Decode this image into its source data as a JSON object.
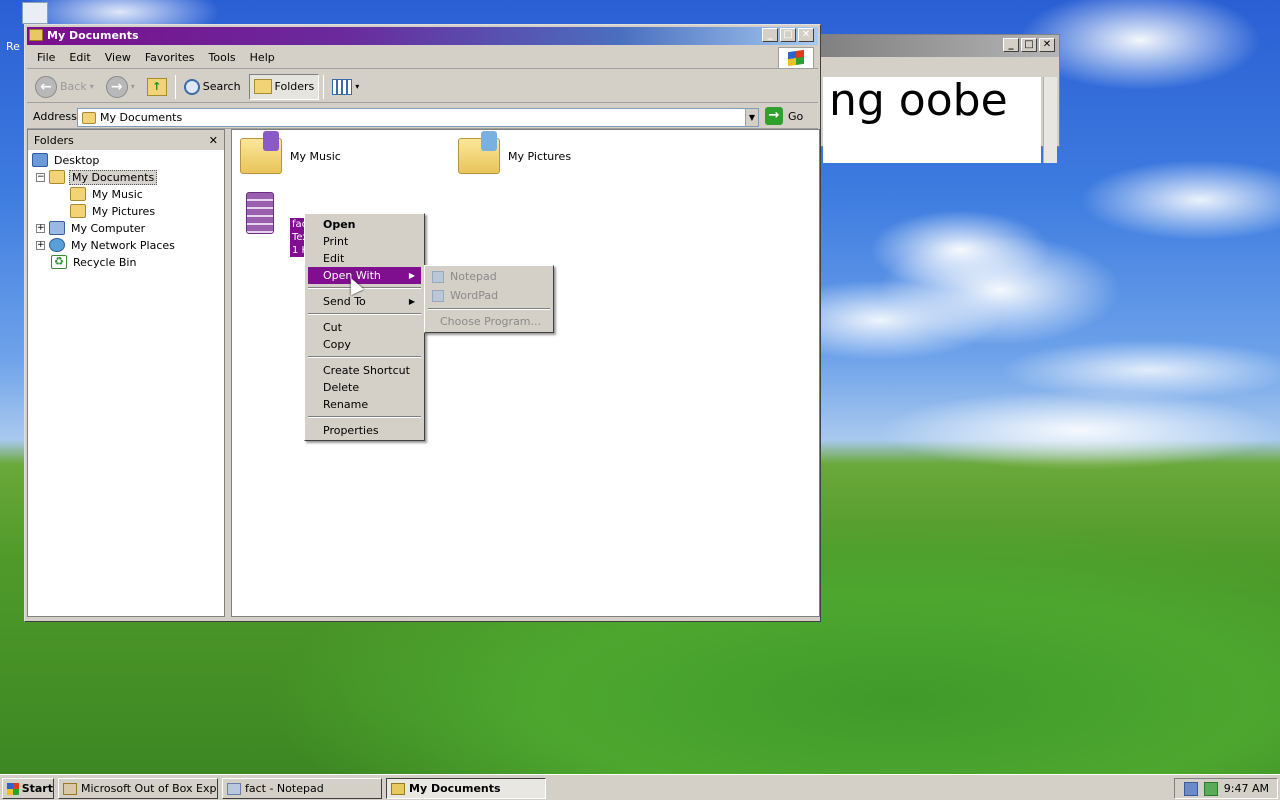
{
  "desktop": {
    "recycle_partial_label": "Re"
  },
  "background_window": {
    "content_text": "ng oobe"
  },
  "window": {
    "title": "My Documents",
    "controls": {
      "minimize": "_",
      "maximize": "□",
      "close": "✕"
    },
    "menu": [
      "File",
      "Edit",
      "View",
      "Favorites",
      "Tools",
      "Help"
    ],
    "toolbar": {
      "back": "Back",
      "search": "Search",
      "folders": "Folders"
    },
    "address": {
      "label": "Address",
      "value": "My Documents",
      "go": "Go"
    }
  },
  "folders_pane": {
    "title": "Folders",
    "close": "✕",
    "tree": [
      {
        "label": "Desktop"
      },
      {
        "label": "My Documents",
        "selected": true
      },
      {
        "label": "My Music"
      },
      {
        "label": "My Pictures"
      },
      {
        "label": "My Computer"
      },
      {
        "label": "My Network Places"
      },
      {
        "label": "Recycle Bin"
      }
    ]
  },
  "content": {
    "items": [
      {
        "label": "My Music"
      },
      {
        "label": "My Pictures"
      }
    ],
    "file": {
      "line1": "fact",
      "line2": "Text Document",
      "line3": "1 KB"
    }
  },
  "context_menu": {
    "items": [
      "Open",
      "Print",
      "Edit",
      "Open With",
      "Send To",
      "Cut",
      "Copy",
      "Create Shortcut",
      "Delete",
      "Rename",
      "Properties"
    ]
  },
  "open_with_menu": {
    "items": [
      "Notepad",
      "WordPad",
      "Choose Program..."
    ]
  },
  "taskbar": {
    "start": "Start",
    "tasks": [
      "Microsoft Out of Box Exp...",
      "fact - Notepad",
      "My Documents"
    ],
    "clock": "9:47 AM"
  },
  "colors": {
    "selection": "#800f8f",
    "title_start": "#7a0f8c",
    "title_end": "#a6caf0"
  }
}
